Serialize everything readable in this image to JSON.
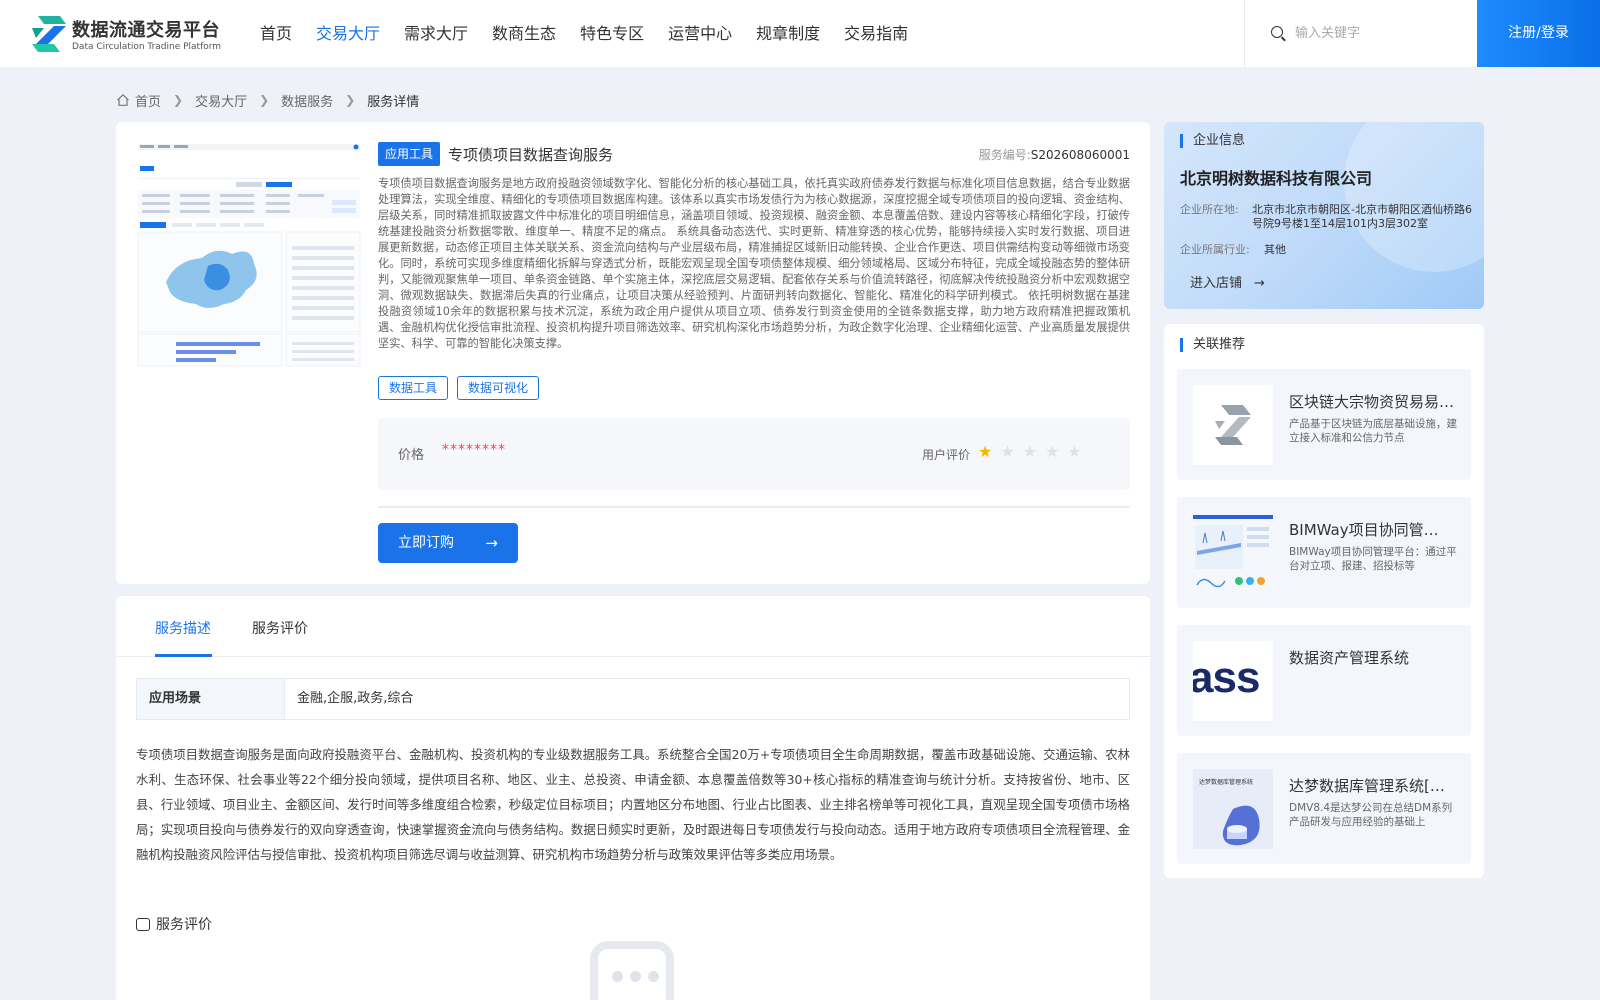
{
  "header": {
    "logo_title": "数据流通交易平台",
    "logo_subtitle": "Data Circulation Tradine Platform",
    "nav": [
      {
        "label": "首页",
        "active": false
      },
      {
        "label": "交易大厅",
        "active": true
      },
      {
        "label": "需求大厅",
        "active": false
      },
      {
        "label": "数商生态",
        "active": false
      },
      {
        "label": "特色专区",
        "active": false
      },
      {
        "label": "运营中心",
        "active": false
      },
      {
        "label": "规章制度",
        "active": false
      },
      {
        "label": "交易指南",
        "active": false
      }
    ],
    "search_placeholder": "输入关键字",
    "login_label": "注册/登录"
  },
  "breadcrumb": [
    "首页",
    "交易大厅",
    "数据服务",
    "服务详情"
  ],
  "product": {
    "tag": "应用工具",
    "title": "专项债项目数据查询服务",
    "service_no_label": "服务编号:",
    "service_no": "S202608060001",
    "description": "专项债项目数据查询服务是地方政府投融资领域数字化、智能化分析的核心基础工具，依托真实政府债券发行数据与标准化项目信息数据，结合专业数据处理算法，实现全维度、精细化的专项债项目数据库构建。该体系以真实市场发债行为为核心数据源，深度挖掘全域专项债项目的投向逻辑、资金结构、层级关系，同时精准抓取披露文件中标准化的项目明细信息，涵盖项目领域、投资规模、融资金额、本息覆盖倍数、建设内容等核心精细化字段，打破传统基建投融资分析数据零散、维度单一、精度不足的痛点。 系统具备动态迭代、实时更新、精准穿透的核心优势，能够持续接入实时发行数据、项目进展更新数据，动态修正项目主体关联关系、资金流向结构与产业层级布局，精准捕捉区域新旧动能转换、企业合作更迭、项目供需结构变动等细微市场变化。同时，系统可实现多维度精细化拆解与穿透式分析，既能宏观呈现全国专项债整体规模、细分领域格局、区域分布特征，完成全域投融态势的整体研判，又能微观聚焦单一项目、单条资金链路、单个实施主体，深挖底层交易逻辑、配套依存关系与价值流转路径，彻底解决传统投融资分析中宏观数据空洞、微观数据缺失、数据滞后失真的行业痛点，让项目决策从经验预判、片面研判转向数据化、智能化、精准化的科学研判模式。 依托明树数据在基建投融资领域10余年的数据积累与技术沉淀，系统为政企用户提供从项目立项、债券发行到资金使用的全链条数据支撑，助力地方政府精准把握政策机遇、金融机构优化授信审批流程、投资机构提升项目筛选效率、研究机构深化市场趋势分析，为政企数字化治理、企业精细化运营、产业高质量发展提供坚实、科学、可靠的智能化决策支撑。",
    "chips": [
      "数据工具",
      "数据可视化"
    ],
    "price_label": "价格",
    "price_value": "********",
    "rating_label": "用户评价",
    "rating": 1,
    "rating_max": 5,
    "buy_label": "立即订购"
  },
  "tabs": [
    {
      "label": "服务描述",
      "active": true
    },
    {
      "label": "服务评价",
      "active": false
    }
  ],
  "scene": {
    "key": "应用场景",
    "value": "金融,企服,政务,综合"
  },
  "long_description": "专项债项目数据查询服务是面向政府投融资平台、金融机构、投资机构的专业级数据服务工具。系统整合全国20万+专项债项目全生命周期数据，覆盖市政基础设施、交通运输、农林水利、生态环保、社会事业等22个细分投向领域，提供项目名称、地区、业主、总投资、申请金额、本息覆盖倍数等30+核心指标的精准查询与统计分析。支持按省份、地市、区县、行业领域、项目业主、金额区间、发行时间等多维度组合检索，秒级定位目标项目；内置地区分布地图、行业占比图表、业主排名榜单等可视化工具，直观呈现全国专项债市场格局；实现项目投向与债券发行的双向穿透查询，快速掌握资金流向与债务结构。数据日频实时更新，及时跟进每日专项债发行与投向动态。适用于地方政府专项债项目全流程管理、金融机构投融资风险评估与授信审批、投资机构项目筛选尽调与收益测算、研究机构市场趋势分析与政策效果评估等多类应用场景。",
  "review_section_title": "服务评价",
  "company": {
    "section_title": "企业信息",
    "name": "北京明树数据科技有限公司",
    "location_label": "企业所在地:",
    "location": "北京市北京市朝阳区-北京市朝阳区酒仙桥路6号院9号楼1至14层101内3层302室",
    "industry_label": "企业所属行业:",
    "industry": "其他",
    "store_label": "进入店铺"
  },
  "related": {
    "section_title": "关联推荐",
    "items": [
      {
        "name": "区块链大宗物资贸易易…",
        "desc": "产品基于区块链为底层基础设施，建立接入标准和公信力节点",
        "thumb": "logo"
      },
      {
        "name": "BIMWay项目协同管…",
        "desc": "BIMWay项目协同管理平台：通过平台对立项、报建、招投标等",
        "thumb": "bim"
      },
      {
        "name": "数据资产管理系统",
        "desc": "",
        "thumb": "text",
        "thumb_text": "ass"
      },
      {
        "name": "达梦数据库管理系统[…",
        "desc": "DMV8.4是达梦公司在总结DM系列产品研发与应用经验的基础上",
        "thumb": "dm",
        "thumb_text": "达梦数据库管理系统"
      }
    ]
  },
  "colors": {
    "accent": "#1a73e8",
    "price": "#f04848",
    "star": "#f7b500",
    "bg": "#eef2f8"
  }
}
